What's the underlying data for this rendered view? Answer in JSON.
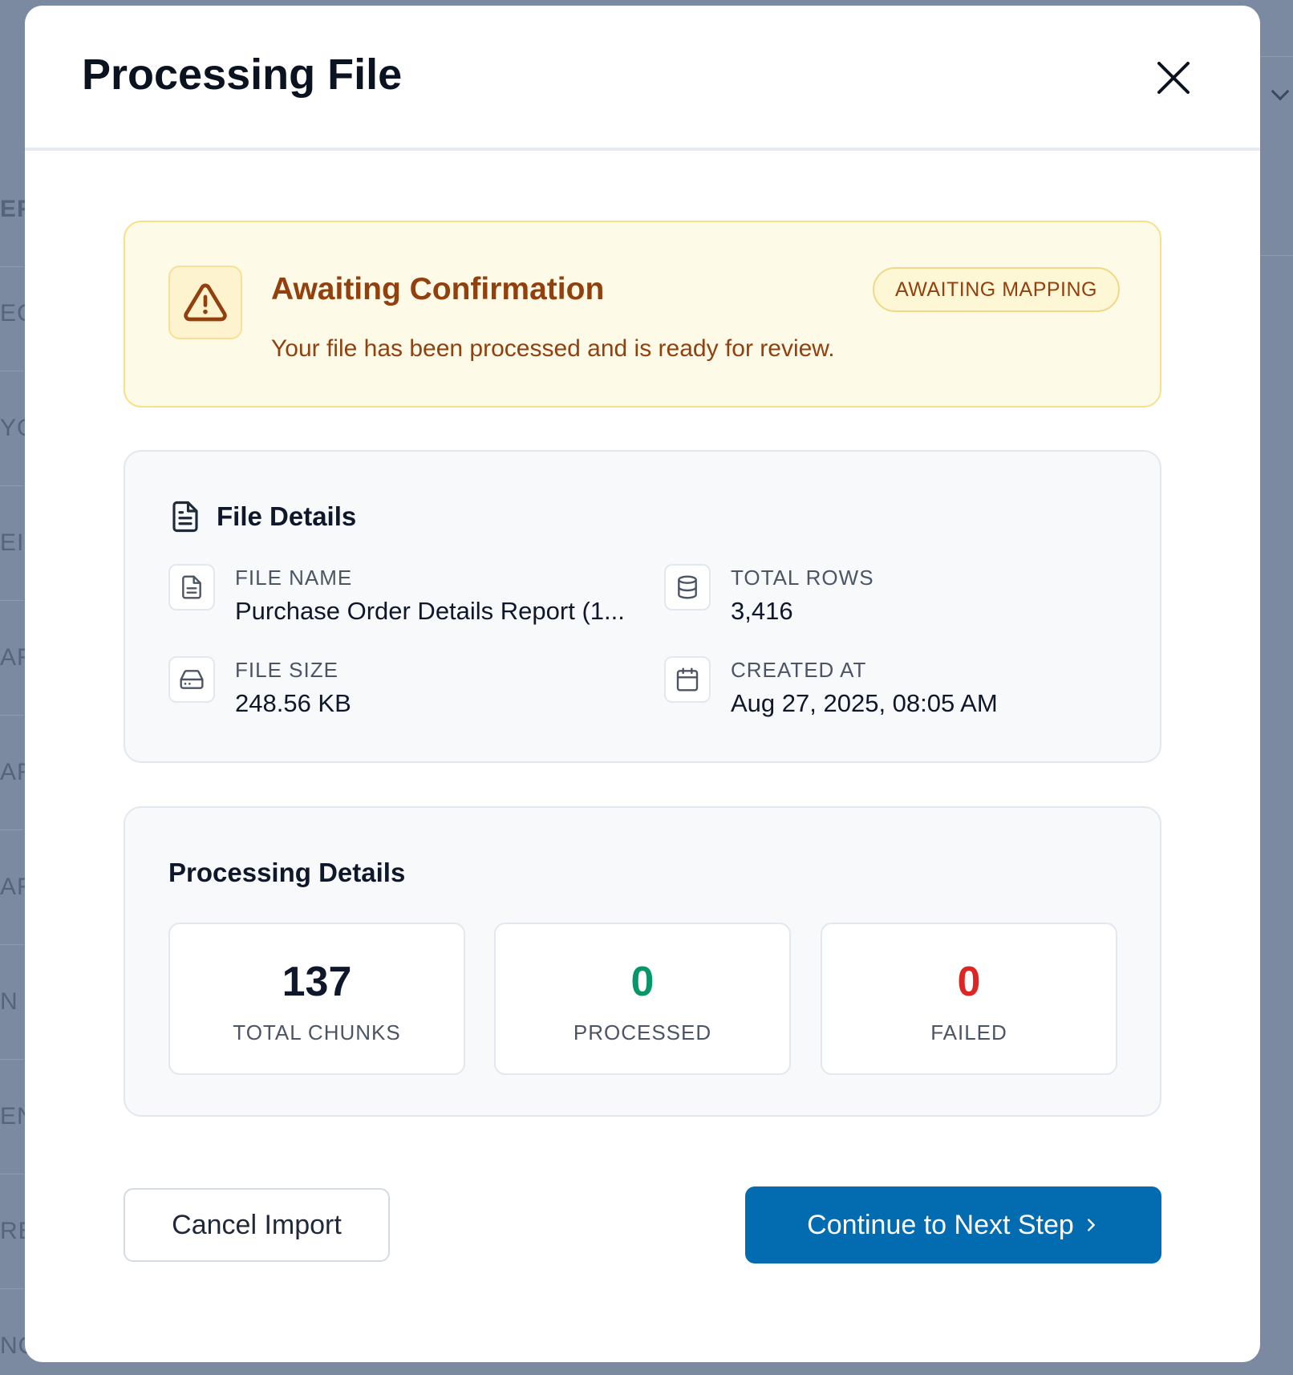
{
  "background": {
    "row_fragments": [
      "ER",
      "EC",
      "YO",
      "EI",
      "AR",
      "AR",
      "AR",
      "N",
      "EN",
      "RE",
      "NO"
    ]
  },
  "modal": {
    "title": "Processing File",
    "close_icon": "close-icon"
  },
  "alert": {
    "title": "Awaiting Confirmation",
    "message": "Your file has been processed and is ready for review.",
    "badge": "AWAITING MAPPING",
    "icon": "warning-triangle-icon",
    "color": "#92400e"
  },
  "file_details": {
    "heading": "File Details",
    "file_name_label": "FILE NAME",
    "file_name": "Purchase Order Details Report (1...",
    "total_rows_label": "TOTAL ROWS",
    "total_rows": "3,416",
    "file_size_label": "FILE SIZE",
    "file_size": "248.56 KB",
    "created_at_label": "CREATED AT",
    "created_at": "Aug 27, 2025, 08:05 AM"
  },
  "processing_details": {
    "heading": "Processing Details",
    "stats": [
      {
        "value": "137",
        "label": "TOTAL CHUNKS",
        "color": "#0f172a"
      },
      {
        "value": "0",
        "label": "PROCESSED",
        "color": "#059669"
      },
      {
        "value": "0",
        "label": "FAILED",
        "color": "#dc2626"
      }
    ]
  },
  "actions": {
    "cancel_label": "Cancel Import",
    "continue_label": "Continue to Next Step",
    "continue_color": "#036bb0"
  }
}
